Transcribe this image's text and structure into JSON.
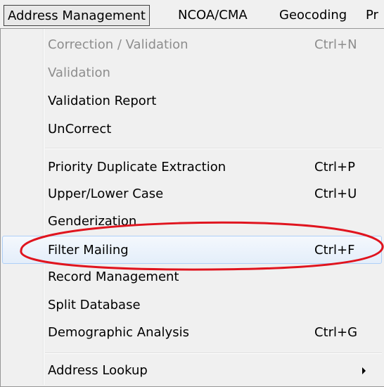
{
  "menubar": {
    "items": [
      {
        "label": "Address Management"
      },
      {
        "label": "NCOA/CMA"
      },
      {
        "label": "Geocoding"
      },
      {
        "label": "Pr"
      }
    ]
  },
  "menu": {
    "items": [
      {
        "label": "Correction / Validation",
        "shortcut": "Ctrl+N",
        "enabled": false
      },
      {
        "label": "Validation",
        "shortcut": "",
        "enabled": false
      },
      {
        "label": "Validation Report",
        "shortcut": "",
        "enabled": true
      },
      {
        "label": "UnCorrect",
        "shortcut": "",
        "enabled": true
      },
      {
        "label": "Priority Duplicate Extraction",
        "shortcut": "Ctrl+P",
        "enabled": true
      },
      {
        "label": "Upper/Lower Case",
        "shortcut": "Ctrl+U",
        "enabled": true
      },
      {
        "label": "Genderization",
        "shortcut": "",
        "enabled": true
      },
      {
        "label": "Filter Mailing",
        "shortcut": "Ctrl+F",
        "enabled": true,
        "highlighted": true
      },
      {
        "label": "Record Management",
        "shortcut": "",
        "enabled": true
      },
      {
        "label": "Split Database",
        "shortcut": "",
        "enabled": true
      },
      {
        "label": "Demographic Analysis",
        "shortcut": "Ctrl+G",
        "enabled": true
      },
      {
        "label": "Address Lookup",
        "shortcut": "",
        "enabled": true,
        "submenu": true
      }
    ]
  },
  "annotation_color": "#e0141e",
  "icons": [
    "submenu-arrow-icon"
  ]
}
